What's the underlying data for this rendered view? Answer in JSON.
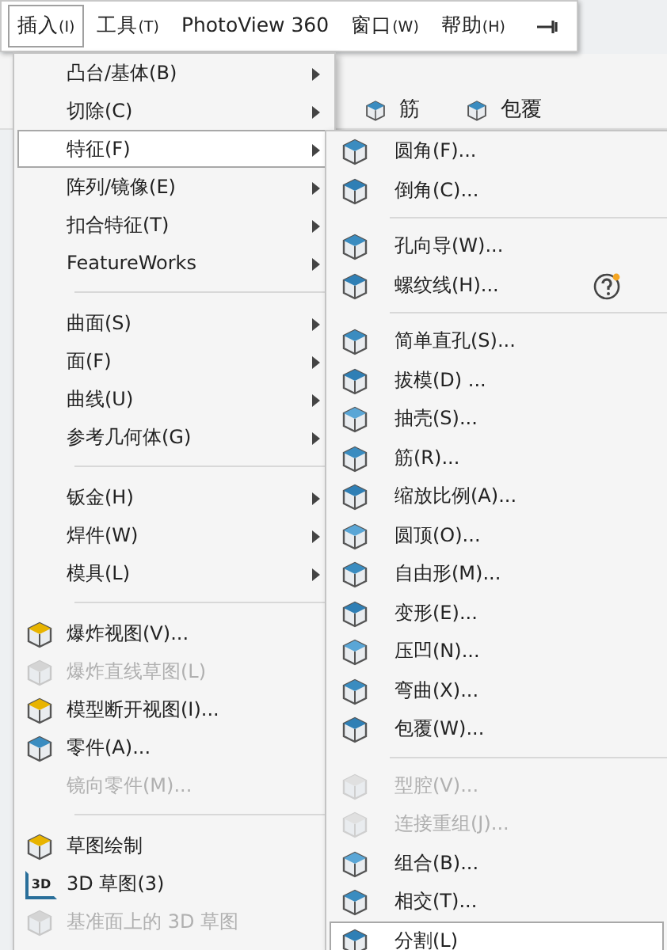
{
  "menu_bar": [
    {
      "label": "插入",
      "accel": "(I)",
      "selected": true
    },
    {
      "label": "工具",
      "accel": "(T)",
      "selected": false
    },
    {
      "label": "PhotoView 360",
      "selected": false
    },
    {
      "label": "窗口",
      "accel": "(W)",
      "selected": false
    },
    {
      "label": "帮助",
      "accel": "(H)",
      "selected": false
    }
  ],
  "toolbar": [
    {
      "label": "筋"
    },
    {
      "label": "包覆"
    }
  ],
  "insert_menu": [
    {
      "kind": "item",
      "label": "凸台/基体(B)",
      "submenu": true,
      "icon": false,
      "disabled": false,
      "selected": false
    },
    {
      "kind": "item",
      "label": "切除(C)",
      "submenu": true,
      "icon": false,
      "disabled": false,
      "selected": false
    },
    {
      "kind": "item",
      "label": "特征(F)",
      "submenu": true,
      "icon": false,
      "disabled": false,
      "selected": true
    },
    {
      "kind": "item",
      "label": "阵列/镜像(E)",
      "submenu": true,
      "icon": false,
      "disabled": false,
      "selected": false
    },
    {
      "kind": "item",
      "label": "扣合特征(T)",
      "submenu": true,
      "icon": false,
      "disabled": false,
      "selected": false
    },
    {
      "kind": "item",
      "label": "FeatureWorks",
      "submenu": true,
      "icon": false,
      "disabled": false,
      "selected": false
    },
    {
      "kind": "separator"
    },
    {
      "kind": "item",
      "label": "曲面(S)",
      "submenu": true,
      "icon": false,
      "disabled": false,
      "selected": false
    },
    {
      "kind": "item",
      "label": "面(F)",
      "submenu": true,
      "icon": false,
      "disabled": false,
      "selected": false
    },
    {
      "kind": "item",
      "label": "曲线(U)",
      "submenu": true,
      "icon": false,
      "disabled": false,
      "selected": false
    },
    {
      "kind": "item",
      "label": "参考几何体(G)",
      "submenu": true,
      "icon": false,
      "disabled": false,
      "selected": false
    },
    {
      "kind": "separator"
    },
    {
      "kind": "item",
      "label": "钣金(H)",
      "submenu": true,
      "icon": false,
      "disabled": false,
      "selected": false
    },
    {
      "kind": "item",
      "label": "焊件(W)",
      "submenu": true,
      "icon": false,
      "disabled": false,
      "selected": false
    },
    {
      "kind": "item",
      "label": "模具(L)",
      "submenu": true,
      "icon": false,
      "disabled": false,
      "selected": false
    },
    {
      "kind": "separator"
    },
    {
      "kind": "item",
      "label": "爆炸视图(V)...",
      "submenu": false,
      "icon": true,
      "disabled": false,
      "selected": false
    },
    {
      "kind": "item",
      "label": "爆炸直线草图(L)",
      "submenu": false,
      "icon": true,
      "disabled": true,
      "selected": false
    },
    {
      "kind": "item",
      "label": "模型断开视图(I)...",
      "submenu": false,
      "icon": true,
      "disabled": false,
      "selected": false
    },
    {
      "kind": "item",
      "label": "零件(A)...",
      "submenu": false,
      "icon": true,
      "disabled": false,
      "selected": false
    },
    {
      "kind": "item",
      "label": "镜向零件(M)...",
      "submenu": false,
      "icon": false,
      "disabled": true,
      "selected": false
    },
    {
      "kind": "separator"
    },
    {
      "kind": "item",
      "label": "草图绘制",
      "submenu": false,
      "icon": true,
      "disabled": false,
      "selected": false
    },
    {
      "kind": "item",
      "label": "3D 草图(3)",
      "submenu": false,
      "icon": true,
      "icon_text": "3D",
      "disabled": false,
      "selected": false
    },
    {
      "kind": "item",
      "label": "基准面上的 3D 草图",
      "submenu": false,
      "icon": true,
      "disabled": true,
      "selected": false
    }
  ],
  "features_menu": [
    {
      "kind": "item",
      "label": "圆角(F)...",
      "disabled": false,
      "selected": false
    },
    {
      "kind": "item",
      "label": "倒角(C)...",
      "disabled": false,
      "selected": false
    },
    {
      "kind": "separator"
    },
    {
      "kind": "item",
      "label": "孔向导(W)...",
      "disabled": false,
      "selected": false
    },
    {
      "kind": "item",
      "label": "螺纹线(H)...",
      "disabled": false,
      "selected": false,
      "help": true
    },
    {
      "kind": "separator"
    },
    {
      "kind": "item",
      "label": "简单直孔(S)...",
      "disabled": false,
      "selected": false
    },
    {
      "kind": "item",
      "label": "拔模(D) ...",
      "disabled": false,
      "selected": false
    },
    {
      "kind": "item",
      "label": "抽壳(S)...",
      "disabled": false,
      "selected": false
    },
    {
      "kind": "item",
      "label": "筋(R)...",
      "disabled": false,
      "selected": false
    },
    {
      "kind": "item",
      "label": "缩放比例(A)...",
      "disabled": false,
      "selected": false
    },
    {
      "kind": "item",
      "label": "圆顶(O)...",
      "disabled": false,
      "selected": false
    },
    {
      "kind": "item",
      "label": "自由形(M)...",
      "disabled": false,
      "selected": false
    },
    {
      "kind": "item",
      "label": "变形(E)...",
      "disabled": false,
      "selected": false
    },
    {
      "kind": "item",
      "label": "压凹(N)...",
      "disabled": false,
      "selected": false
    },
    {
      "kind": "item",
      "label": "弯曲(X)...",
      "disabled": false,
      "selected": false
    },
    {
      "kind": "item",
      "label": "包覆(W)...",
      "disabled": false,
      "selected": false
    },
    {
      "kind": "separator"
    },
    {
      "kind": "item",
      "label": "型腔(V)...",
      "disabled": true,
      "selected": false
    },
    {
      "kind": "item",
      "label": "连接重组(J)...",
      "disabled": true,
      "selected": false
    },
    {
      "kind": "item",
      "label": "组合(B)...",
      "disabled": false,
      "selected": false
    },
    {
      "kind": "item",
      "label": "相交(T)...",
      "disabled": false,
      "selected": false
    },
    {
      "kind": "item",
      "label": "分割(L)",
      "disabled": false,
      "selected": true
    }
  ]
}
